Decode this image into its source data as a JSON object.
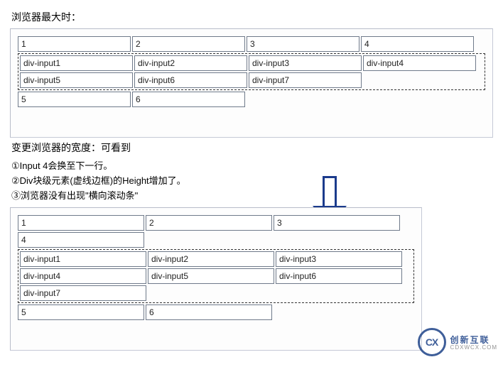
{
  "section1": {
    "caption": "浏览器最大时：",
    "row_top": [
      "1",
      "2",
      "3",
      "4"
    ],
    "div_inputs": [
      "div-input1",
      "div-input2",
      "div-input3",
      "div-input4",
      "div-input5",
      "div-input6",
      "div-input7"
    ],
    "row_bottom": [
      "5",
      "6"
    ]
  },
  "transition": {
    "caption": "变更浏览器的宽度：可看到",
    "bullets": [
      "①Input 4会换至下一行。",
      "②Div块级元素(虚线边框)的Height增加了。",
      "③浏览器没有出现\"横向滚动条\""
    ]
  },
  "section2": {
    "row_top_line1": [
      "1",
      "2",
      "3"
    ],
    "row_top_line2": [
      "4"
    ],
    "div_inputs_line1": [
      "div-input1",
      "div-input2",
      "div-input3"
    ],
    "div_inputs_line2": [
      "div-input4",
      "div-input5",
      "div-input6"
    ],
    "div_inputs_line3": [
      "div-input7"
    ],
    "row_bottom": [
      "5",
      "6"
    ]
  },
  "watermark": {
    "logo_text": "CX",
    "brand": "创新互联",
    "sub": "CDXWCX.COM"
  }
}
